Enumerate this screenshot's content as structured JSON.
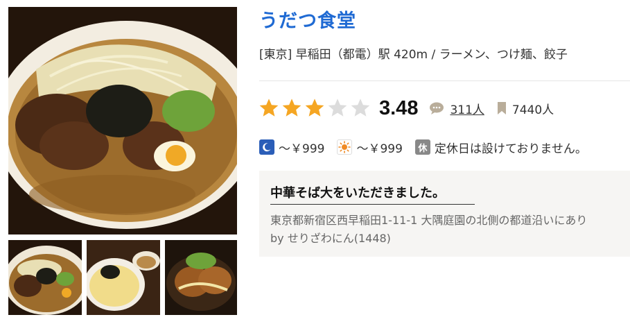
{
  "shop": {
    "name": "うだつ食堂",
    "meta": "[東京] 早稲田（都電）駅 420m / ラーメン、つけ麺、餃子"
  },
  "rating": {
    "value": 3.48,
    "value_text": "3.48",
    "stars": 3,
    "max_stars": 5,
    "review_count": "311人",
    "saved_count": "7440人"
  },
  "prices": {
    "dinner": "～￥999",
    "lunch": "～￥999",
    "closed_badge": "休",
    "holiday": "定休日は設けておりません。"
  },
  "review": {
    "title": "中華そば大をいただきました。",
    "snippet": "東京都新宿区西早稲田1-11-1 大隅庭園の北側の都道沿いにあり",
    "by_label": "by",
    "author": "せりざわにん(1448)"
  },
  "icons": {
    "star_on": "#f5a623",
    "star_off": "#dcdcdc",
    "comment": "speech-bubble-icon",
    "bookmark": "bookmark-icon",
    "night": "moon-icon",
    "day": "sun-icon"
  },
  "colors": {
    "title": "#1f6ad3",
    "star_filled": "#f5a623",
    "star_empty": "#dcdcdc",
    "night_badge": "#2b5eb8",
    "sun": "#f08a24",
    "closed_badge": "#888888",
    "card_bg": "#f6f5f3"
  }
}
